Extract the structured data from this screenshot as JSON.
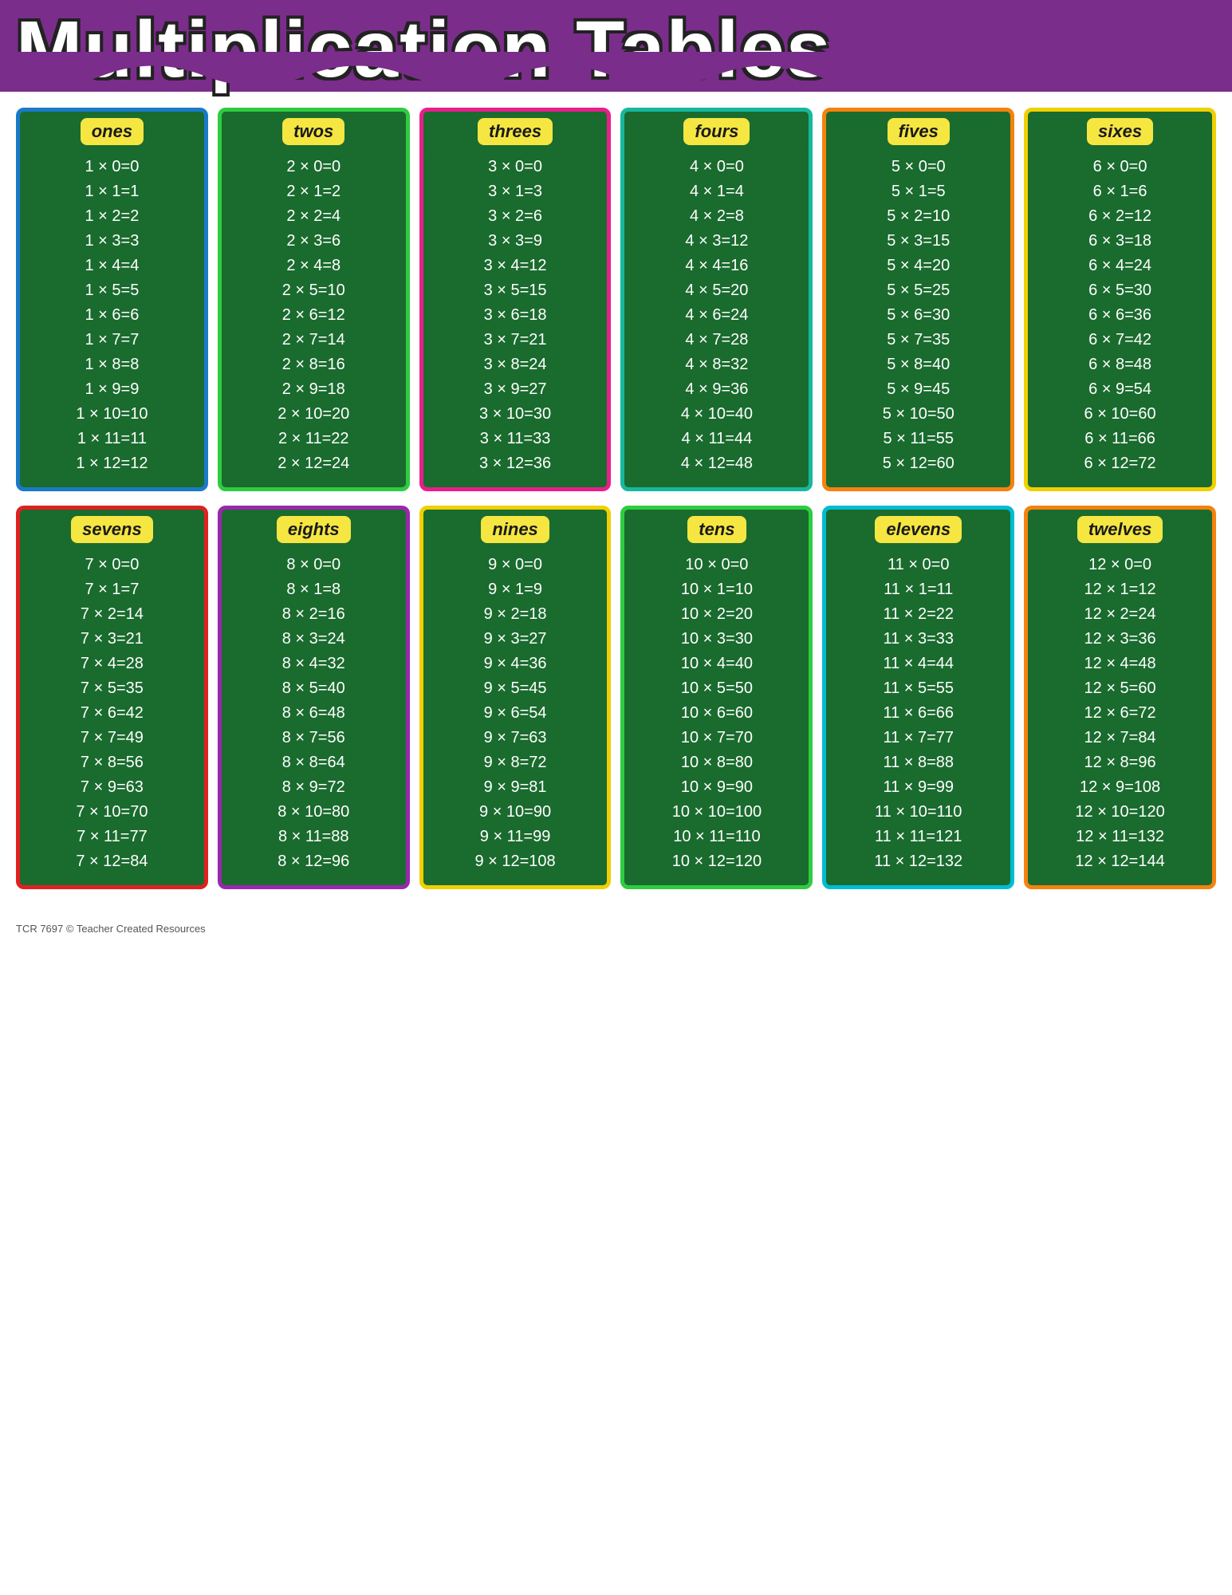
{
  "title": "Multiplication Tables",
  "footer": "TCR 7697  © Teacher Created Resources",
  "tables": [
    {
      "id": "ones",
      "label": "ones",
      "borderClass": "card-blue",
      "rows": [
        "1×0=0",
        "1×1=1",
        "1×2=2",
        "1×3=3",
        "1×4=4",
        "1×5=5",
        "1×6=6",
        "1×7=7",
        "1×8=8",
        "1×9=9",
        "1×10=10",
        "1×11=11",
        "1×12=12"
      ]
    },
    {
      "id": "twos",
      "label": "twos",
      "borderClass": "card-green",
      "rows": [
        "2×0=0",
        "2×1=2",
        "2×2=4",
        "2×3=6",
        "2×4=8",
        "2×5=10",
        "2×6=12",
        "2×7=14",
        "2×8=16",
        "2×9=18",
        "2×10=20",
        "2×11=22",
        "2×12=24"
      ]
    },
    {
      "id": "threes",
      "label": "threes",
      "borderClass": "card-pink",
      "rows": [
        "3×0=0",
        "3×1=3",
        "3×2=6",
        "3×3=9",
        "3×4=12",
        "3×5=15",
        "3×6=18",
        "3×7=21",
        "3×8=24",
        "3×9=27",
        "3×10=30",
        "3×11=33",
        "3×12=36"
      ]
    },
    {
      "id": "fours",
      "label": "fours",
      "borderClass": "card-teal",
      "rows": [
        "4×0=0",
        "4×1=4",
        "4×2=8",
        "4×3=12",
        "4×4=16",
        "4×5=20",
        "4×6=24",
        "4×7=28",
        "4×8=32",
        "4×9=36",
        "4×10=40",
        "4×11=44",
        "4×12=48"
      ]
    },
    {
      "id": "fives",
      "label": "fives",
      "borderClass": "card-orange",
      "rows": [
        "5×0=0",
        "5×1=5",
        "5×2=10",
        "5×3=15",
        "5×4=20",
        "5×5=25",
        "5×6=30",
        "5×7=35",
        "5×8=40",
        "5×9=45",
        "5×10=50",
        "5×11=55",
        "5×12=60"
      ]
    },
    {
      "id": "sixes",
      "label": "sixes",
      "borderClass": "card-yellow",
      "rows": [
        "6×0=0",
        "6×1=6",
        "6×2=12",
        "6×3=18",
        "6×4=24",
        "6×5=30",
        "6×6=36",
        "6×7=42",
        "6×8=48",
        "6×9=54",
        "6×10=60",
        "6×11=66",
        "6×12=72"
      ]
    },
    {
      "id": "sevens",
      "label": "sevens",
      "borderClass": "card-red",
      "rows": [
        "7×0=0",
        "7×1=7",
        "7×2=14",
        "7×3=21",
        "7×4=28",
        "7×5=35",
        "7×6=42",
        "7×7=49",
        "7×8=56",
        "7×9=63",
        "7×10=70",
        "7×11=77",
        "7×12=84"
      ]
    },
    {
      "id": "eights",
      "label": "eights",
      "borderClass": "card-purple",
      "rows": [
        "8×0=0",
        "8×1=8",
        "8×2=16",
        "8×3=24",
        "8×4=32",
        "8×5=40",
        "8×6=48",
        "8×7=56",
        "8×8=64",
        "8×9=72",
        "8×10=80",
        "8×11=88",
        "8×12=96"
      ]
    },
    {
      "id": "nines",
      "label": "nines",
      "borderClass": "card-yellow",
      "rows": [
        "9×0=0",
        "9×1=9",
        "9×2=18",
        "9×3=27",
        "9×4=36",
        "9×5=45",
        "9×6=54",
        "9×7=63",
        "9×8=72",
        "9×9=81",
        "9×10=90",
        "9×11=99",
        "9×12=108"
      ]
    },
    {
      "id": "tens",
      "label": "tens",
      "borderClass": "card-green",
      "rows": [
        "10×0=0",
        "10×1=10",
        "10×2=20",
        "10×3=30",
        "10×4=40",
        "10×5=50",
        "10×6=60",
        "10×7=70",
        "10×8=80",
        "10×9=90",
        "10×10=100",
        "10×11=110",
        "10×12=120"
      ]
    },
    {
      "id": "elevens",
      "label": "elevens",
      "borderClass": "card-lightblue",
      "rows": [
        "11×0=0",
        "11×1=11",
        "11×2=22",
        "11×3=33",
        "11×4=44",
        "11×5=55",
        "11×6=66",
        "11×7=77",
        "11×8=88",
        "11×9=99",
        "11×10=110",
        "11×11=121",
        "11×12=132"
      ]
    },
    {
      "id": "twelves",
      "label": "twelves",
      "borderClass": "card-orange",
      "rows": [
        "12×0=0",
        "12×1=12",
        "12×2=24",
        "12×3=36",
        "12×4=48",
        "12×5=60",
        "12×6=72",
        "12×7=84",
        "12×8=96",
        "12×9=108",
        "12×10=120",
        "12×11=132",
        "12×12=144"
      ]
    }
  ]
}
